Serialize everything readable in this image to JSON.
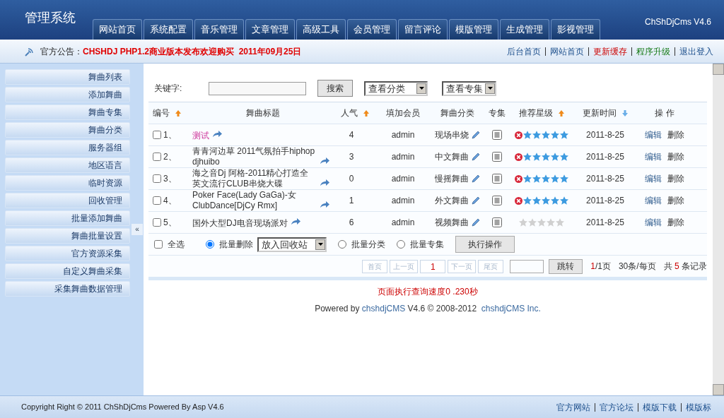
{
  "header": {
    "title": "管理系统",
    "version": "ChShDjCms V4.6",
    "nav": [
      "网站首页",
      "系统配置",
      "音乐管理",
      "文章管理",
      "高级工具",
      "会员管理",
      "留言评论",
      "模版管理",
      "生成管理",
      "影视管理"
    ]
  },
  "notice": {
    "label": "官方公告：",
    "text": "CHSHDJ PHP1.2商业版本发布欢迎购买  2011年09月25日",
    "links": [
      {
        "label": "后台首页",
        "kind": "normal"
      },
      {
        "label": "网站首页",
        "kind": "normal"
      },
      {
        "label": "更新缓存",
        "kind": "alert"
      },
      {
        "label": "程序升级",
        "kind": "upgrade"
      },
      {
        "label": "退出登入",
        "kind": "normal"
      }
    ]
  },
  "sidebar": {
    "items": [
      "舞曲列表",
      "添加舞曲",
      "舞曲专集",
      "舞曲分类",
      "服务器组",
      "地区语言",
      "临时资源",
      "回收管理",
      "批量添加舞曲",
      "舞曲批量设置",
      "官方资源采集",
      "自定义舞曲采集",
      "采集舞曲数据管理"
    ],
    "toggle": "«"
  },
  "search": {
    "label": "关键字:",
    "button": "搜索",
    "selects": [
      "查看分类",
      "查看专集"
    ]
  },
  "table": {
    "columns": [
      {
        "label": "编号",
        "sortable": true,
        "descending": false
      },
      {
        "label": "舞曲标题",
        "sortable": false
      },
      {
        "label": "人气",
        "sortable": true,
        "descending": false
      },
      {
        "label": "填加会员",
        "sortable": false
      },
      {
        "label": "舞曲分类",
        "sortable": false
      },
      {
        "label": "专集",
        "sortable": false
      },
      {
        "label": "推荐星级",
        "sortable": true,
        "descending": false
      },
      {
        "label": "更新时间",
        "sortable": true,
        "descending": true
      },
      {
        "label": "操 作",
        "sortable": false
      }
    ],
    "rows": [
      {
        "checked": false,
        "no": "1、",
        "title": "测试",
        "highlight": true,
        "hits": "4",
        "member": "admin",
        "category": "现场串烧",
        "stars": 5,
        "date": "2011-8-25",
        "actions": [
          "编辑",
          "删除"
        ]
      },
      {
        "checked": false,
        "no": "2、",
        "title": "青青河边草 2011气氛拍手hiphop djhuibo",
        "highlight": false,
        "hits": "3",
        "member": "admin",
        "category": "中文舞曲",
        "stars": 5,
        "date": "2011-8-25",
        "actions": [
          "编辑",
          "删除"
        ]
      },
      {
        "checked": false,
        "no": "3、",
        "title": "海之音Dj 阿格-2011精心打造全英文流行CLUB串烧大碟",
        "highlight": false,
        "hits": "0",
        "member": "admin",
        "category": "慢摇舞曲",
        "stars": 5,
        "date": "2011-8-25",
        "actions": [
          "编辑",
          "删除"
        ]
      },
      {
        "checked": false,
        "no": "4、",
        "title": "Poker Face(Lady GaGa)-女ClubDance[DjCy Rmx]",
        "highlight": false,
        "hits": "1",
        "member": "admin",
        "category": "外文舞曲",
        "stars": 5,
        "date": "2011-8-25",
        "actions": [
          "编辑",
          "删除"
        ]
      },
      {
        "checked": false,
        "no": "5、",
        "title": "国外大型DJ电音现场派对",
        "highlight": false,
        "hits": "6",
        "member": "admin",
        "category": "视频舞曲",
        "stars": 0,
        "date": "2011-8-25",
        "actions": [
          "编辑",
          "删除"
        ]
      }
    ]
  },
  "batch": {
    "select_all": {
      "label": "全选",
      "checked": false
    },
    "options": [
      {
        "label": "批量删除",
        "selected": true
      },
      {
        "label": "批量分类",
        "selected": false
      },
      {
        "label": "批量专集",
        "selected": false
      }
    ],
    "target": "放入回收站",
    "button": "执行操作"
  },
  "pager": {
    "buttons": [
      {
        "label": "首页",
        "disabled": true
      },
      {
        "label": "上一页",
        "disabled": true
      },
      {
        "label": "1",
        "disabled": false
      },
      {
        "label": "下一页",
        "disabled": true
      },
      {
        "label": "尾页",
        "disabled": true
      }
    ],
    "jump": "跳转",
    "current": "1",
    "pages": "/1页",
    "per_page": "30条/每页",
    "total_prefix": "共",
    "total": "5",
    "total_suffix": "条记录"
  },
  "timing": "页面执行查询速度0 .230秒",
  "powered": {
    "prefix": "Powered by",
    "product": "chshdjCMS",
    "middle": "V4.6 © 2008-2012",
    "company": "chshdjCMS Inc."
  },
  "footer": {
    "copyright": "Copyright Right © 2011 ChShDjCms Powered By Asp V4.6",
    "links": [
      "官方网站",
      "官方论坛",
      "模版下载",
      "模版标"
    ]
  }
}
